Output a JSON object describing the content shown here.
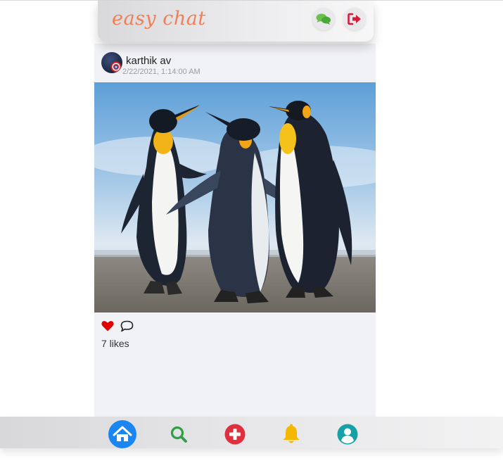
{
  "app": {
    "brand": "easy chat"
  },
  "header": {
    "chat_icon": "comments-icon",
    "logout_icon": "sign-out-icon"
  },
  "post": {
    "username": "karthik av",
    "timestamp": "2/22/2021, 1:14:00 AM",
    "image": "penguins-photo",
    "likes_text": "7 likes",
    "liked": true
  },
  "bottom_nav": {
    "items": [
      {
        "icon": "home-icon",
        "active": true,
        "color": "#1a86f2"
      },
      {
        "icon": "search-icon",
        "active": false,
        "color": "#2f9e44"
      },
      {
        "icon": "add-post-icon",
        "active": false,
        "color": "#e0303f"
      },
      {
        "icon": "bell-icon",
        "active": false,
        "color": "#f5b800"
      },
      {
        "icon": "profile-icon",
        "active": false,
        "color": "#18a0a7"
      }
    ]
  },
  "colors": {
    "brand": "#f07f56",
    "like_red": "#e00000",
    "feed_bg": "#f1f2f5"
  }
}
